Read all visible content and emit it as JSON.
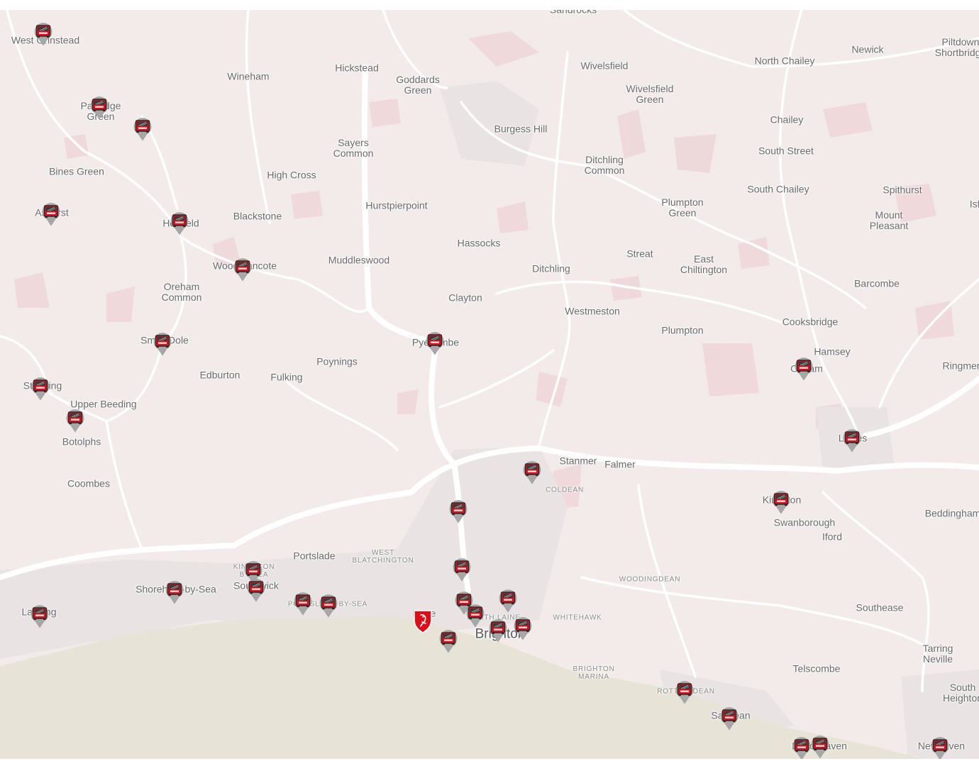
{
  "map": {
    "colors": {
      "land": "#f2ebea",
      "sea": "#e7e3d6",
      "road": "#ffffff",
      "built_up": "#e9e3e3",
      "patch": "#eed6d8",
      "marker_gray": "#a7a7a7",
      "marker_red": "#d9101b"
    },
    "places": [
      {
        "text": "Sandrocks"
      },
      {
        "text": "West Grinstead"
      },
      {
        "text": "Wineham"
      },
      {
        "text": "Hickstead"
      },
      {
        "text": "Goddards",
        "text2": "Green"
      },
      {
        "text": "Wivelsfield"
      },
      {
        "text": "North Chailey"
      },
      {
        "text": "Newick"
      },
      {
        "text": "Piltdown",
        "text2": "Shortbridge"
      },
      {
        "text": "Partridge",
        "text2": "Green"
      },
      {
        "text": "Wivelsfield",
        "text2": "Green"
      },
      {
        "text": "Burgess Hill"
      },
      {
        "text": "Chailey"
      },
      {
        "text": "Sayers",
        "text2": "Common"
      },
      {
        "text": "South Street"
      },
      {
        "text": "Ditchling",
        "text2": "Common"
      },
      {
        "text": "Bines Green"
      },
      {
        "text": "High Cross"
      },
      {
        "text": "South Chailey"
      },
      {
        "text": "Spithurst"
      },
      {
        "text": "Isfield"
      },
      {
        "text": "Hurstpierpoint"
      },
      {
        "text": "Plumpton",
        "text2": "Green"
      },
      {
        "text": "Ashurst"
      },
      {
        "text": "Henfield"
      },
      {
        "text": "Blackstone"
      },
      {
        "text": "Mount",
        "text2": "Pleasant"
      },
      {
        "text": "Hassocks"
      },
      {
        "text": "Streat"
      },
      {
        "text": "East",
        "text2": "Chiltington"
      },
      {
        "text": "Woodmancote"
      },
      {
        "text": "Muddleswood"
      },
      {
        "text": "Ditchling"
      },
      {
        "text": "Barcombe"
      },
      {
        "text": "Oreham",
        "text2": "Common"
      },
      {
        "text": "Clayton"
      },
      {
        "text": "Westmeston"
      },
      {
        "text": "Cooksbridge"
      },
      {
        "text": "Plumpton"
      },
      {
        "text": "Small Dole"
      },
      {
        "text": "Pyecombe"
      },
      {
        "text": "Hamsey"
      },
      {
        "text": "Poynings"
      },
      {
        "text": "Offham"
      },
      {
        "text": "Ringmer"
      },
      {
        "text": "Steyning"
      },
      {
        "text": "Edburton"
      },
      {
        "text": "Fulking"
      },
      {
        "text": "Upper Beeding"
      },
      {
        "text": "Lewes"
      },
      {
        "text": "Botolphs"
      },
      {
        "text": "Stanmer"
      },
      {
        "text": "Falmer"
      },
      {
        "text": "Coombes"
      },
      {
        "text": "COLDEAN",
        "style": "small"
      },
      {
        "text": "Kingston"
      },
      {
        "text": "Beddingham"
      },
      {
        "text": "Swanborough"
      },
      {
        "text": "Iford"
      },
      {
        "text": "Portslade"
      },
      {
        "text": "WEST",
        "text2": "BLATCHINGTON",
        "style": "small"
      },
      {
        "text": "KINGSTON",
        "text2": "BY SEA",
        "style": "small"
      },
      {
        "text": "Shoreham-by-Sea"
      },
      {
        "text": "Southwick"
      },
      {
        "text": "WOODINGDEAN",
        "style": "small"
      },
      {
        "text": "PORTSLADE-BY-SEA",
        "style": "small"
      },
      {
        "text": "Lancing"
      },
      {
        "text": "Southease"
      },
      {
        "text": "Hove"
      },
      {
        "text": "NORTH LAINE",
        "style": "small"
      },
      {
        "text": "WHITEHAWK",
        "style": "small"
      },
      {
        "text": "Brighton",
        "style": "big"
      },
      {
        "text": "Tarring",
        "text2": "Neville"
      },
      {
        "text": "BRIGHTON",
        "text2": "MARINA",
        "style": "small"
      },
      {
        "text": "Telscombe"
      },
      {
        "text": "ROTTINGDEAN",
        "style": "small"
      },
      {
        "text": "South",
        "text2": "Heighton"
      },
      {
        "text": "Saltdean"
      },
      {
        "text": "Peacehaven"
      },
      {
        "text": "Newhaven"
      }
    ],
    "markers": [
      {
        "icon": "school-bus-marker-icon"
      },
      {
        "icon": "school-bus-marker-icon"
      },
      {
        "icon": "school-bus-marker-icon"
      },
      {
        "icon": "school-bus-marker-icon"
      },
      {
        "icon": "school-bus-marker-icon"
      },
      {
        "icon": "school-bus-marker-icon"
      },
      {
        "icon": "school-bus-marker-icon"
      },
      {
        "icon": "school-bus-marker-icon"
      },
      {
        "icon": "school-bus-marker-icon"
      },
      {
        "icon": "school-bus-marker-icon"
      },
      {
        "icon": "school-bus-marker-icon"
      },
      {
        "icon": "school-bus-marker-icon"
      },
      {
        "icon": "school-bus-marker-icon"
      },
      {
        "icon": "school-bus-marker-icon"
      },
      {
        "icon": "school-bus-marker-icon"
      },
      {
        "icon": "school-bus-marker-icon"
      },
      {
        "icon": "school-bus-marker-icon"
      },
      {
        "icon": "school-bus-marker-icon"
      },
      {
        "icon": "school-bus-marker-icon"
      },
      {
        "icon": "school-bus-marker-icon"
      },
      {
        "icon": "school-bus-marker-icon"
      },
      {
        "icon": "school-bus-marker-icon"
      },
      {
        "icon": "school-bus-marker-icon"
      },
      {
        "icon": "school-bus-marker-icon"
      },
      {
        "icon": "school-bus-marker-icon"
      },
      {
        "icon": "school-bus-marker-icon"
      },
      {
        "icon": "school-bus-marker-icon"
      },
      {
        "icon": "school-bus-marker-icon"
      },
      {
        "icon": "school-bus-marker-icon"
      },
      {
        "icon": "school-bus-marker-icon"
      },
      {
        "icon": "school-bus-marker-icon"
      },
      {
        "icon": "school-bus-marker-icon"
      },
      {
        "icon": "school-bus-marker-icon"
      }
    ],
    "school_marker": {
      "icon": "school-crest-marker-icon"
    }
  }
}
